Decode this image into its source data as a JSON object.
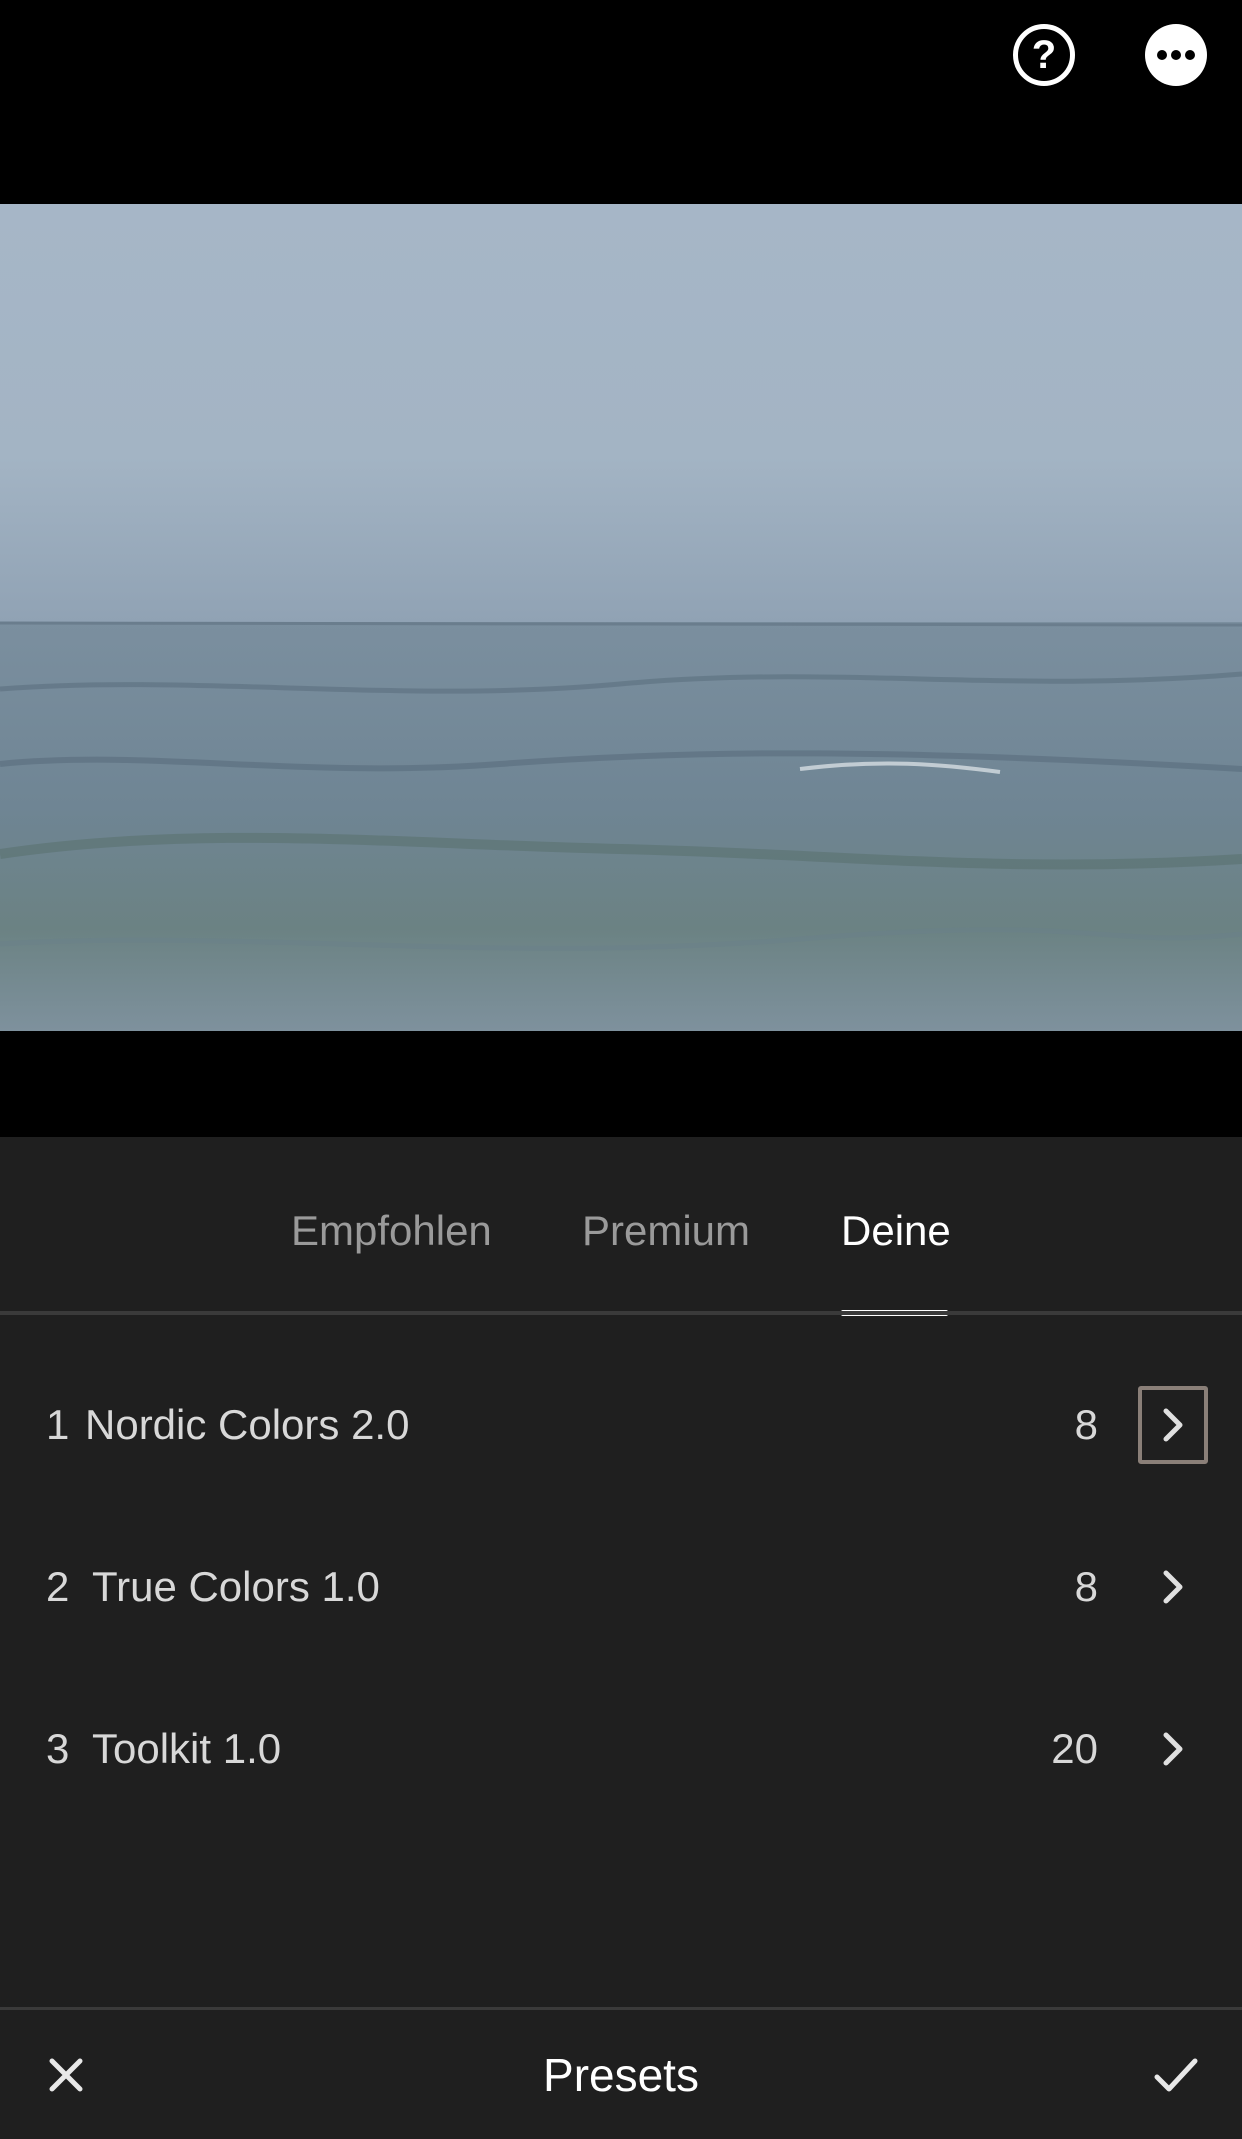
{
  "header": {
    "help_icon": "help-icon",
    "more_icon": "more-options-icon"
  },
  "tabs": [
    {
      "label": "Empfohlen",
      "active": false
    },
    {
      "label": "Premium",
      "active": false
    },
    {
      "label": "Deine",
      "active": true
    }
  ],
  "presets": [
    {
      "index": "1",
      "name": "Nordic Colors 2.0",
      "count": "8"
    },
    {
      "index": "2",
      "name": "True Colors 1.0",
      "count": "8"
    },
    {
      "index": "3",
      "name": "Toolkit 1.0",
      "count": "20"
    }
  ],
  "bottombar": {
    "title": "Presets",
    "close_icon": "close-icon",
    "confirm_icon": "checkmark-icon"
  },
  "colors": {
    "panel_bg": "#1f1f1f",
    "active_tab": "#ffffff",
    "inactive_tab": "#9a9a9a",
    "focus_border": "#8a7f78"
  }
}
